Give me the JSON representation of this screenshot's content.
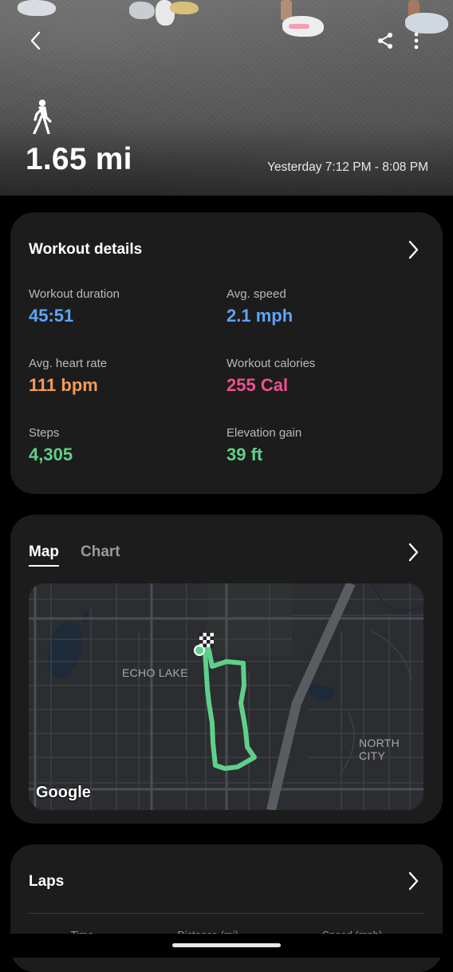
{
  "hero": {
    "distance": "1.65 mi",
    "timespan": "Yesterday 7:12 PM - 8:08 PM",
    "activity_icon": "walk-icon",
    "back_icon": "chevron-left-icon",
    "share_icon": "share-icon",
    "more_icon": "more-vertical-icon"
  },
  "details": {
    "title": "Workout details",
    "stats": [
      {
        "label": "Workout duration",
        "value": "45:51",
        "color": "#5ea3f5"
      },
      {
        "label": "Avg. speed",
        "value": "2.1 mph",
        "color": "#5ea3f5"
      },
      {
        "label": "Avg. heart rate",
        "value": "111 bpm",
        "color": "#f59b5a"
      },
      {
        "label": "Workout calories",
        "value": "255 Cal",
        "color": "#f0508f"
      },
      {
        "label": "Steps",
        "value": "4,305",
        "color": "#5fd089"
      },
      {
        "label": "Elevation gain",
        "value": "39 ft",
        "color": "#5fd089"
      }
    ]
  },
  "map_card": {
    "tabs": [
      {
        "label": "Map",
        "active": true
      },
      {
        "label": "Chart",
        "active": false
      }
    ],
    "places": [
      "ECHO LAKE",
      "NORTH CITY"
    ],
    "attribution": "Google",
    "route_color": "#5fd089"
  },
  "laps": {
    "title": "Laps",
    "columns": [
      "Time",
      "Distance (mi)",
      "Speed (mph)"
    ]
  }
}
